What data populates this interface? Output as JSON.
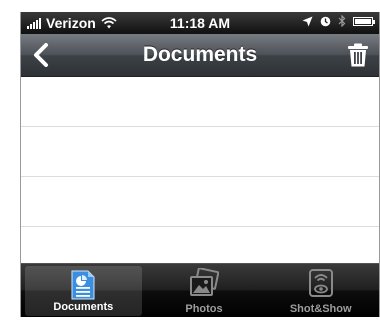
{
  "status_bar": {
    "carrier": "Verizon",
    "time": "11:18 AM"
  },
  "nav_bar": {
    "title": "Documents",
    "icons": [
      "back-chevron-icon",
      "trash-icon"
    ]
  },
  "list": {
    "rows": [
      "",
      "",
      "",
      ""
    ]
  },
  "tab_bar": {
    "tabs": [
      {
        "label": "Documents",
        "icon": "document-icon",
        "active": true
      },
      {
        "label": "Photos",
        "icon": "photos-icon",
        "active": false
      },
      {
        "label": "Shot&Show",
        "icon": "shot-show-icon",
        "active": false
      }
    ]
  },
  "colors": {
    "navbar": "#4c5157",
    "tabbar": "#000000",
    "active_icon": "#3b8fe0"
  }
}
